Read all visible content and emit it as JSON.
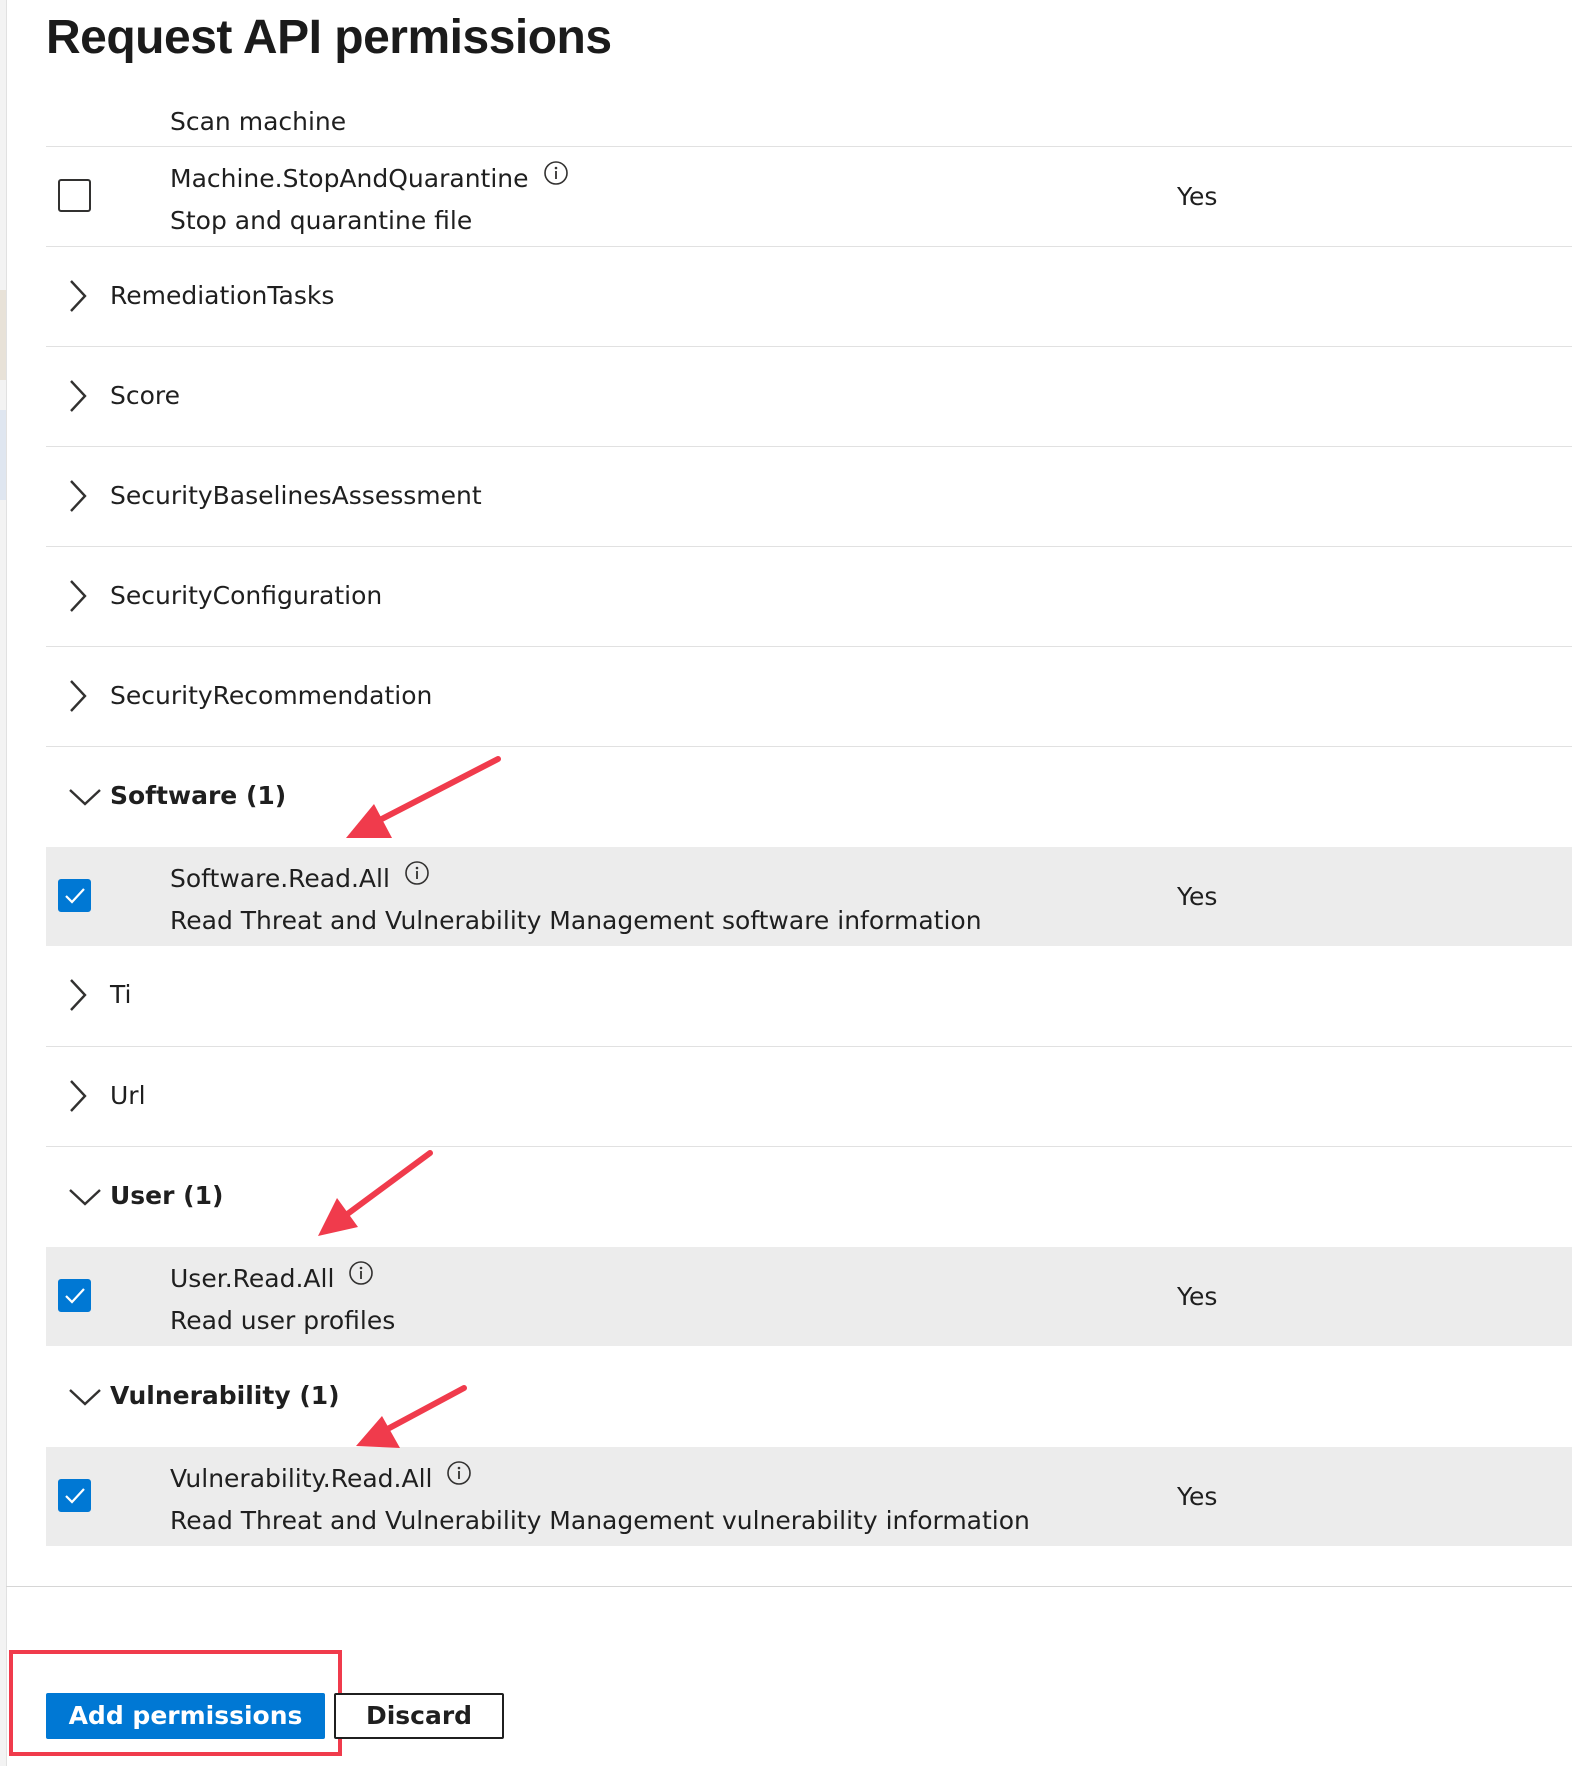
{
  "page": {
    "title": "Request API permissions"
  },
  "partial_row": {
    "description": "Scan machine"
  },
  "permission_stop": {
    "name": "Machine.StopAndQuarantine",
    "description": "Stop and quarantine file",
    "admin_consent": "Yes",
    "checked": false
  },
  "groups": {
    "remediation": {
      "label": "RemediationTasks"
    },
    "score": {
      "label": "Score"
    },
    "baselines": {
      "label": "SecurityBaselinesAssessment"
    },
    "configuration": {
      "label": "SecurityConfiguration"
    },
    "recommendation": {
      "label": "SecurityRecommendation"
    },
    "software": {
      "label": "Software (1)"
    },
    "ti": {
      "label": "Ti"
    },
    "url": {
      "label": "Url"
    },
    "user": {
      "label": "User (1)"
    },
    "vulnerability": {
      "label": "Vulnerability (1)"
    }
  },
  "permission_software": {
    "name": "Software.Read.All",
    "description": "Read Threat and Vulnerability Management software information",
    "admin_consent": "Yes",
    "checked": true
  },
  "permission_user": {
    "name": "User.Read.All",
    "description": "Read user profiles",
    "admin_consent": "Yes",
    "checked": true
  },
  "permission_vuln": {
    "name": "Vulnerability.Read.All",
    "description": "Read Threat and Vulnerability Management vulnerability information",
    "admin_consent": "Yes",
    "checked": true
  },
  "footer": {
    "add_label": "Add permissions",
    "discard_label": "Discard"
  },
  "colors": {
    "accent": "#0078d4",
    "annotation": "#f03b4c",
    "selected_row": "#ececec"
  },
  "icons": {
    "info": "info-icon",
    "collapsed": "chevron-right-icon",
    "expanded": "chevron-down-icon",
    "check": "checkmark-icon"
  }
}
